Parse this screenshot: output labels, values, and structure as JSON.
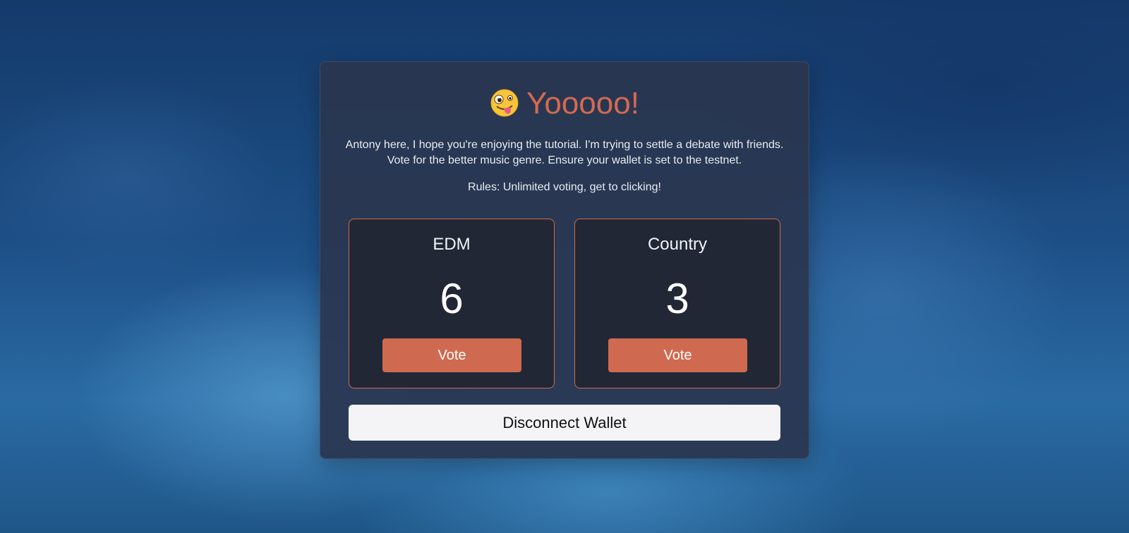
{
  "card": {
    "title": "Yooooo!",
    "title_icon": "zany-face-icon",
    "intro_line1": "Antony here, I hope you're enjoying the tutorial. I'm trying to settle a debate with friends.",
    "intro_line2": "Vote for the better music genre. Ensure your wallet is set to the testnet.",
    "rules": "Rules: Unlimited voting, get to clicking!"
  },
  "options": [
    {
      "name": "EDM",
      "votes": "6",
      "vote_label": "Vote"
    },
    {
      "name": "Country",
      "votes": "3",
      "vote_label": "Vote"
    }
  ],
  "wallet": {
    "disconnect_label": "Disconnect Wallet"
  },
  "colors": {
    "accent": "#cf6a50",
    "card_bg": "#2a3650",
    "option_bg": "#212734",
    "button_light": "#f4f4f6"
  }
}
